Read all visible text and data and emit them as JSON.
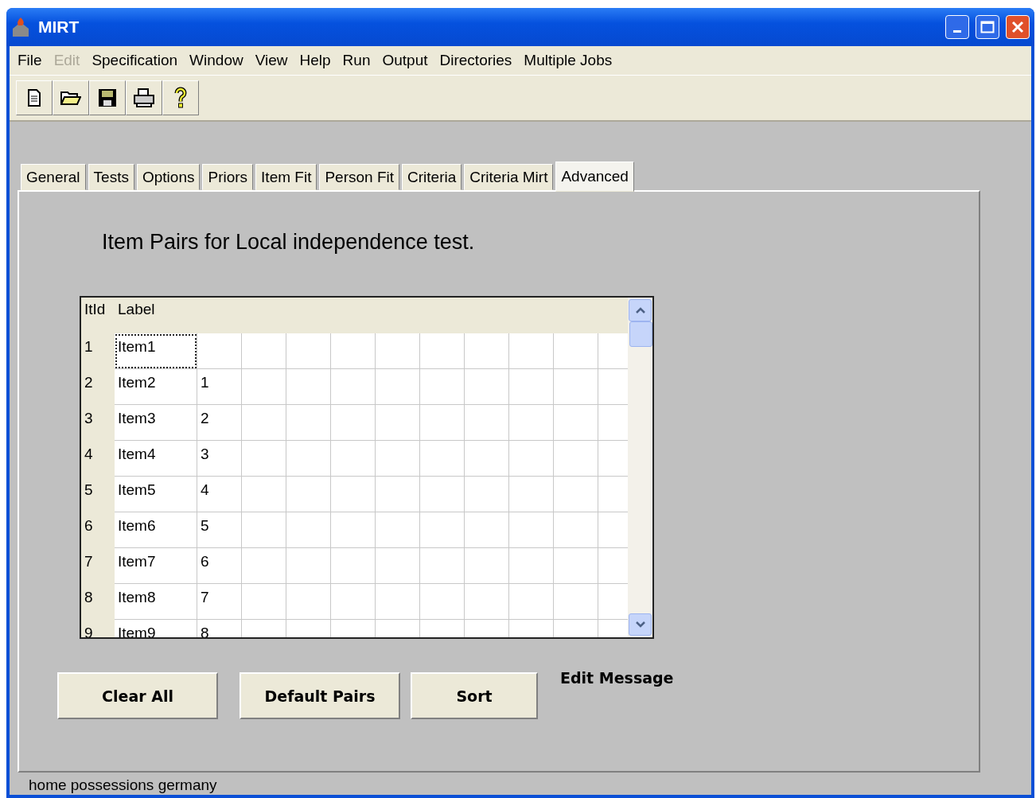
{
  "window": {
    "title": "MIRT"
  },
  "menu": [
    {
      "label": "File",
      "disabled": false
    },
    {
      "label": "Edit",
      "disabled": true
    },
    {
      "label": "Specification",
      "disabled": false
    },
    {
      "label": "Window",
      "disabled": false
    },
    {
      "label": "View",
      "disabled": false
    },
    {
      "label": "Help",
      "disabled": false
    },
    {
      "label": "Run",
      "disabled": false
    },
    {
      "label": "Output",
      "disabled": false
    },
    {
      "label": "Directories",
      "disabled": false
    },
    {
      "label": "Multiple Jobs",
      "disabled": false
    }
  ],
  "toolbar": [
    {
      "kind": "new"
    },
    {
      "kind": "open"
    },
    {
      "kind": "save"
    },
    {
      "kind": "print"
    },
    {
      "kind": "help"
    }
  ],
  "tabs": [
    {
      "label": "General",
      "selected": false
    },
    {
      "label": "Tests",
      "selected": false
    },
    {
      "label": "Options",
      "selected": false
    },
    {
      "label": "Priors",
      "selected": false
    },
    {
      "label": "Item Fit",
      "selected": false
    },
    {
      "label": "Person Fit",
      "selected": false
    },
    {
      "label": "Criteria",
      "selected": false
    },
    {
      "label": "Criteria Mirt",
      "selected": false
    },
    {
      "label": "Advanced",
      "selected": true
    }
  ],
  "heading": "Item Pairs for Local independence test.",
  "table": {
    "columns": [
      "ItId",
      "Label"
    ],
    "rows": [
      {
        "id": "1",
        "label": "Item1",
        "focused": true
      },
      {
        "id": "2",
        "label": "Item2",
        "pair": "1",
        "focused": false
      },
      {
        "id": "3",
        "label": "Item3",
        "pair": "2",
        "focused": false
      },
      {
        "id": "4",
        "label": "Item4",
        "pair": "3",
        "focused": false
      },
      {
        "id": "5",
        "label": "Item5",
        "pair": "4",
        "focused": false
      },
      {
        "id": "6",
        "label": "Item6",
        "pair": "5",
        "focused": false
      },
      {
        "id": "7",
        "label": "Item7",
        "pair": "6",
        "focused": false
      },
      {
        "id": "8",
        "label": "Item8",
        "pair": "7",
        "focused": false
      },
      {
        "id": "9",
        "label": "Item9",
        "pair": "8",
        "focused": false
      }
    ]
  },
  "buttons": [
    "Clear All",
    "Default Pairs",
    "Sort"
  ],
  "edit_message": "Edit Message",
  "status_bar": "home possessions germany"
}
